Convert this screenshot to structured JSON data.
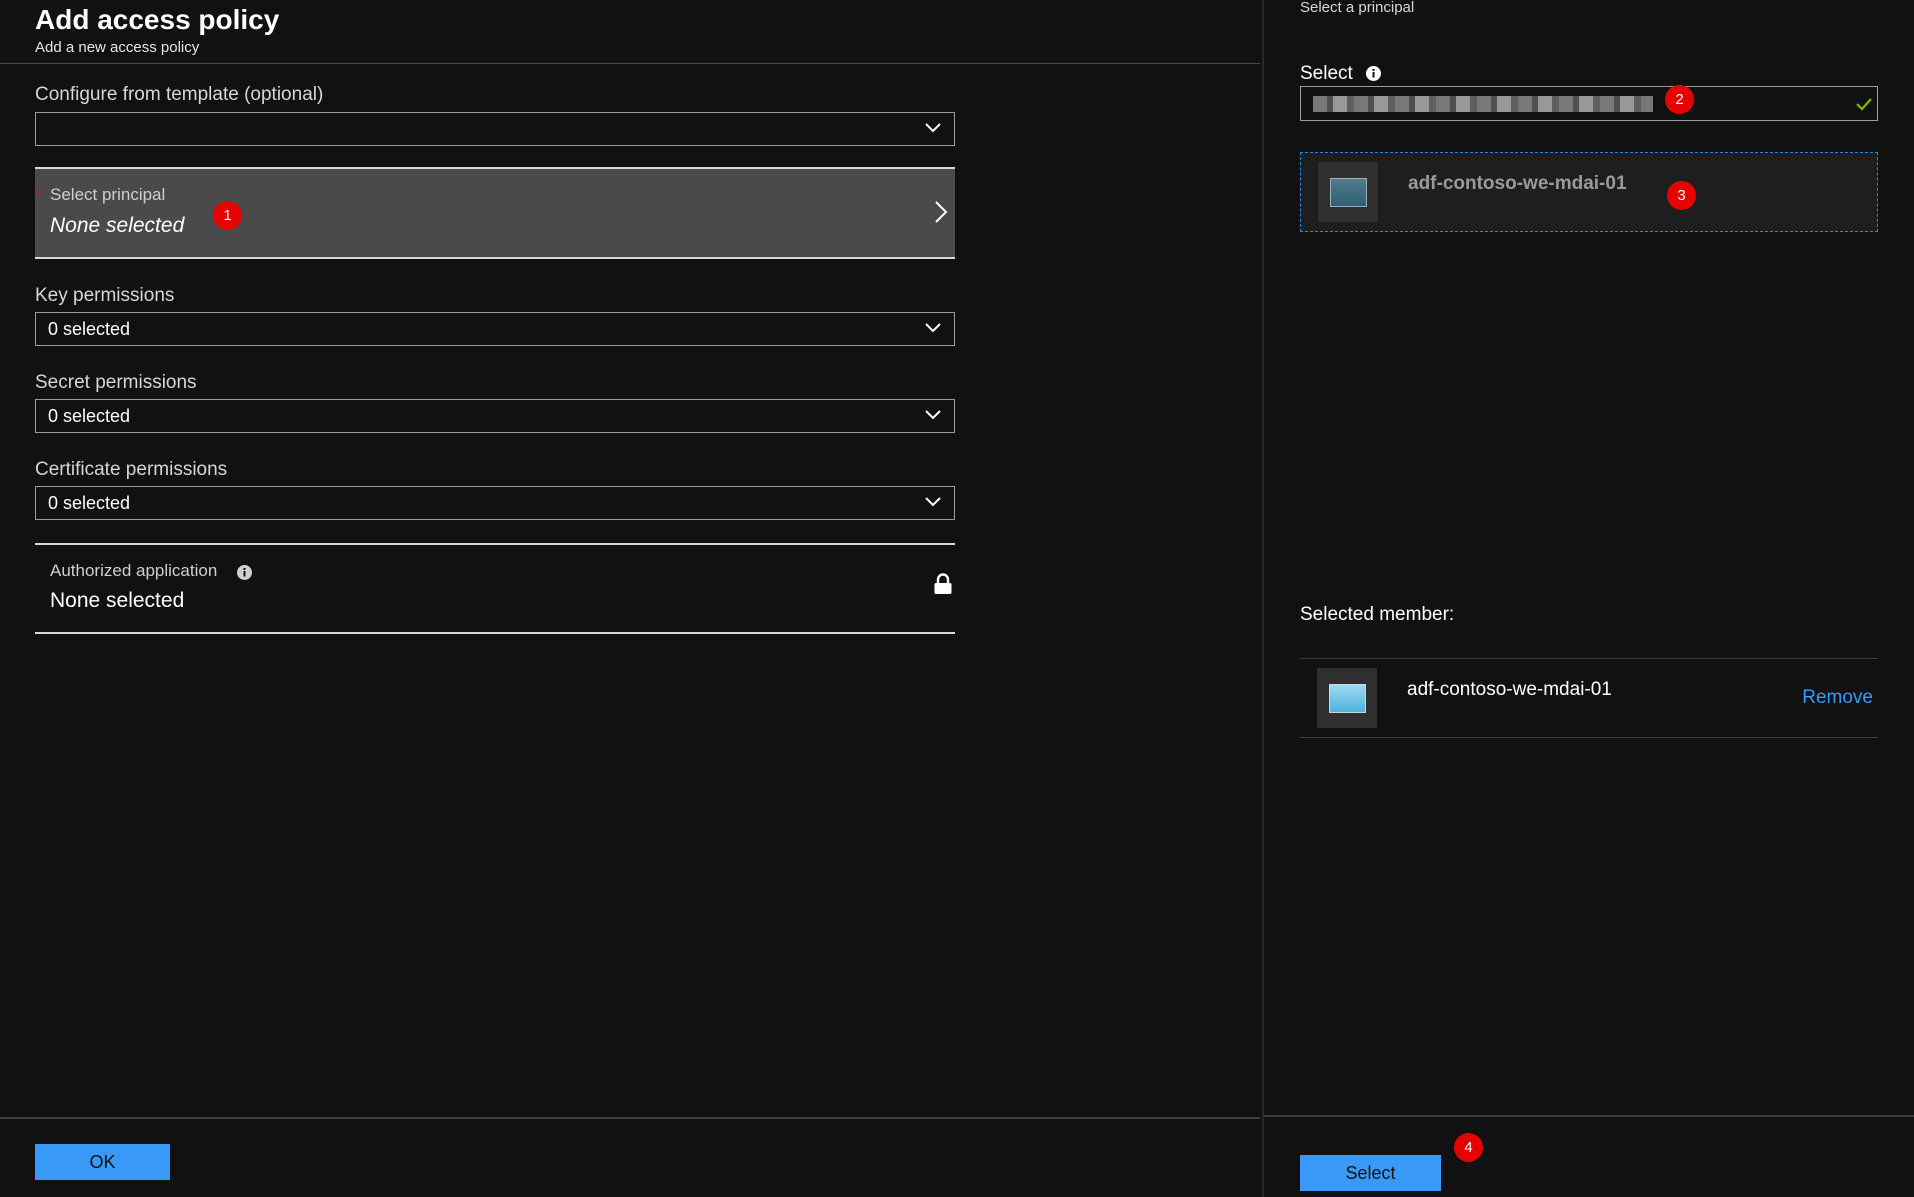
{
  "left_blade": {
    "title": "Add access policy",
    "subtitle": "Add a new access policy",
    "template": {
      "label": "Configure from template (optional)",
      "value": ""
    },
    "principal": {
      "label": "Select principal",
      "value": "None selected",
      "required": true
    },
    "key_permissions": {
      "label": "Key permissions",
      "value": "0 selected"
    },
    "secret_permissions": {
      "label": "Secret permissions",
      "value": "0 selected"
    },
    "certificate_permissions": {
      "label": "Certificate permissions",
      "value": "0 selected"
    },
    "authorized_application": {
      "label": "Authorized application",
      "value": "None selected"
    },
    "ok_label": "OK"
  },
  "right_blade": {
    "title": "Select a principal",
    "select_label": "Select",
    "search_value_obscured": true,
    "result": {
      "name": "adf-contoso-we-mdai-01"
    },
    "selected_member_heading": "Selected member:",
    "member": {
      "name": "adf-contoso-we-mdai-01",
      "remove_label": "Remove"
    },
    "select_button_label": "Select"
  },
  "badges": {
    "b1": "1",
    "b2": "2",
    "b3": "3",
    "b4": "4"
  },
  "icons": {
    "dropdown": "chevron-down-icon",
    "principal_nav": "chevron-right-icon",
    "info": "info-icon",
    "lock": "lock-icon",
    "valid": "checkmark-icon",
    "app": "app-window-icon"
  },
  "colors": {
    "background": "#111111",
    "accent": "#3899f6",
    "badge": "#e60000",
    "required": "#e81123",
    "valid_check": "#7fba00"
  }
}
